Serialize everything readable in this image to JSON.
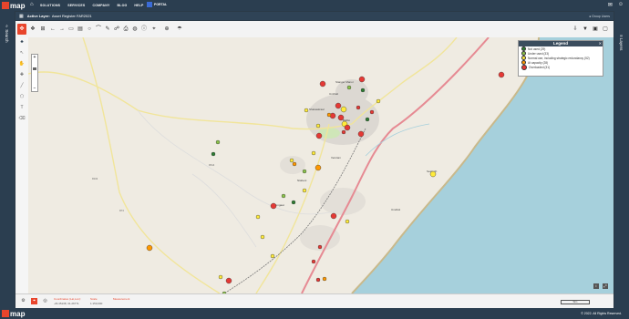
{
  "brand": {
    "logo_text": "map"
  },
  "nav": {
    "items": [
      "SOLUTIONS",
      "SERVICES",
      "COMPANY",
      "BLOG",
      "HELP"
    ],
    "portal": "PORTAL"
  },
  "layer": {
    "label": "Active Layer:",
    "value": "Asset Register FAR2021",
    "group_label": "Group Users"
  },
  "sidebar": {
    "search_tab": "Search",
    "layers_tab": "Layers"
  },
  "legend": {
    "title": "Legend",
    "items": [
      {
        "label": "Not used (29)",
        "color": "#2e7d32"
      },
      {
        "label": "Under used (33)",
        "color": "#8bc34a"
      },
      {
        "label": "Normal use, including strategic redundancy (52)",
        "color": "#ffeb3b"
      },
      {
        "label": "At capacity (28)",
        "color": "#ff9800"
      },
      {
        "label": "Overloaded (31)",
        "color": "#e53935"
      }
    ]
  },
  "map": {
    "places": [
      "Stanger Manor",
      "Ballito",
      "Shakaskraal",
      "Ntabeni",
      "Tongaat",
      "Umhlali",
      "Salt Rock",
      "Seaforth",
      "Verulam",
      "Umdloti",
      "Driefontein",
      "Redcliffe",
      "Hazelmere",
      "Ottawa",
      "Waterloo",
      "Umhloti Beach",
      "Sheffield Beach",
      "Compensation"
    ],
    "road_labels": [
      "R102",
      "R614",
      "R74",
      "M4",
      "N2"
    ]
  },
  "bottombar": {
    "coordinates_label": "Coordinates (Lat,Lon):",
    "coordinates_value": "-29.45138, 31.26771",
    "scale_label": "Scale",
    "scale_value": "1:150,000",
    "measurement_label": "Measurement",
    "scale_bar": "5km"
  },
  "footer": {
    "copyright": "© 2022. All Rights Reserved."
  },
  "colors": {
    "accent": "#e8452c",
    "navbar": "#2b3e50",
    "sea": "#a6d0dc",
    "land": "#efebe2"
  }
}
